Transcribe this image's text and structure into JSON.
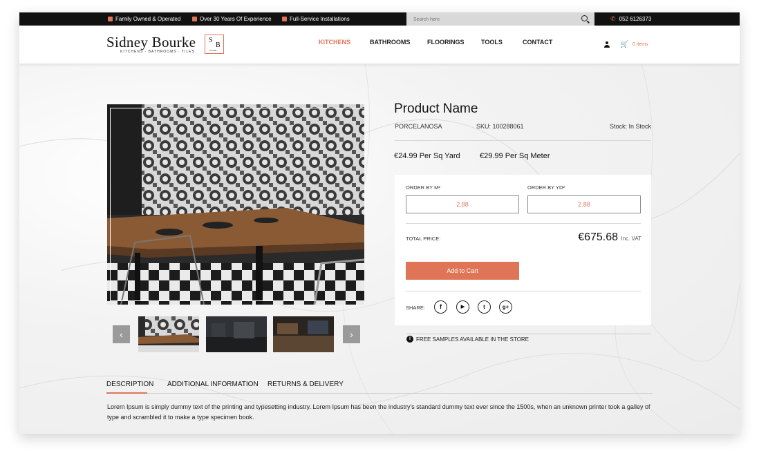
{
  "topbar": {
    "items": [
      "Family Owned & Operated",
      "Over 30 Years Of Experience",
      "Full-Service Installations"
    ],
    "search_placeholder": "Search here",
    "phone": "052 6126373"
  },
  "logo": {
    "name": "Sidney Bourke",
    "tagline": "KITCHENS · BATHROOMS · TILES",
    "mono_s": "S",
    "mono_b": "B",
    "mono_est": "est 1992"
  },
  "nav": {
    "items": [
      "KITCHENS",
      "BATHROOMS",
      "FLOORINGS",
      "TOOLS",
      "CONTACT"
    ],
    "active": "KITCHENS"
  },
  "cart": {
    "label": "0 items"
  },
  "product": {
    "name": "Product Name",
    "brand": "PORCELANOSA",
    "sku": "SKU: 100288061",
    "stock": "Stock: In Stock",
    "price_yard": "€24.99 Per Sq Yard",
    "price_meter": "€29.99 Per Sq Meter"
  },
  "order": {
    "m2_label": "ORDER BY M²",
    "m2_value": "2.88",
    "yd2_label": "ORDER BY YD²",
    "yd2_value": "2.88",
    "total_label": "TOTAL PRICE:",
    "total_value": "€675.68",
    "total_suffix": "Inc. VAT",
    "add_to_cart": "Add to Cart",
    "share_label": "SHARE:"
  },
  "samples_note": "FREE SAMPLES AVAILABLE IN THE STORE",
  "tabs": {
    "items": [
      "DESCRIPTION",
      "ADDITIONAL INFORMATION",
      "RETURNS & DELIVERY"
    ],
    "active": "DESCRIPTION"
  },
  "description": "Lorem Ipsum is simply dummy text of the printing and typesetting industry. Lorem Ipsum has been the industry's standard dummy text ever since the 1500s, when an unknown printer took a galley of type and scrambled it to make a type specimen book.",
  "colors": {
    "accent": "#e07456",
    "topbar": "#111111"
  },
  "icons": {
    "share": [
      "facebook-icon",
      "youtube-icon",
      "twitter-icon",
      "google-plus-icon"
    ]
  }
}
